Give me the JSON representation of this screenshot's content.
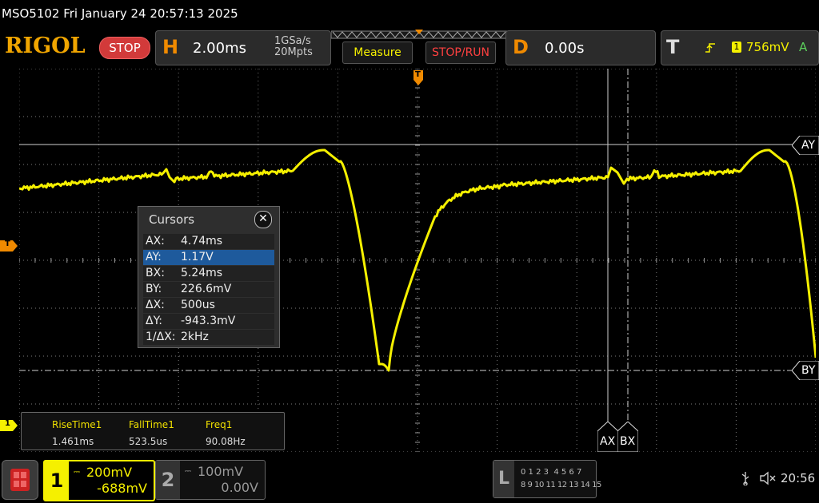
{
  "title": "MSO5102  Fri January 24 20:57:13 2025",
  "brand": "RIGOL",
  "run_state": "STOP",
  "horizontal": {
    "letter": "H",
    "timebase": "2.00ms",
    "sample_rate": "1GSa/s",
    "memory_depth": "20Mpts"
  },
  "buttons": {
    "measure": "Measure",
    "stop_run": "STOP/RUN"
  },
  "delay": {
    "letter": "D",
    "value": "0.00s"
  },
  "trigger": {
    "letter": "T",
    "channel": "1",
    "level": "756mV",
    "mode": "A"
  },
  "markers": {
    "trigger_pos": "T",
    "trigger_level": "T",
    "ch1": "1",
    "ay": "AY",
    "by": "BY",
    "ax": "AX",
    "bx": "BX"
  },
  "cursors": {
    "title": "Cursors",
    "close": "✕",
    "rows": [
      {
        "key": "AX:",
        "value": "4.74ms"
      },
      {
        "key": "AY:",
        "value": "1.17V"
      },
      {
        "key": "BX:",
        "value": "5.24ms"
      },
      {
        "key": "BY:",
        "value": "226.6mV"
      },
      {
        "key": "ΔX:",
        "value": "500us"
      },
      {
        "key": "ΔY:",
        "value": "-943.3mV"
      },
      {
        "key": "1/ΔX:",
        "value": "2kHz"
      }
    ]
  },
  "measurements": [
    {
      "label": "RiseTime1",
      "value": "1.461ms"
    },
    {
      "label": "FallTime1",
      "value": "523.5us"
    },
    {
      "label": "Freq1",
      "value": "90.08Hz"
    }
  ],
  "ch1": {
    "num": "1",
    "scale": "200mV",
    "offset": "-688mV"
  },
  "ch2": {
    "num": "2",
    "scale": "100mV",
    "offset": "0.00V"
  },
  "logic": {
    "letter": "L",
    "row1": "0 1 2 3  4 5 6 7",
    "row2": "8 9 10 11 12 13 14 15"
  },
  "clock": "20:56",
  "colors": {
    "ch1": "#f5f000",
    "accent": "#f08a00",
    "stop": "#d23a3a"
  }
}
